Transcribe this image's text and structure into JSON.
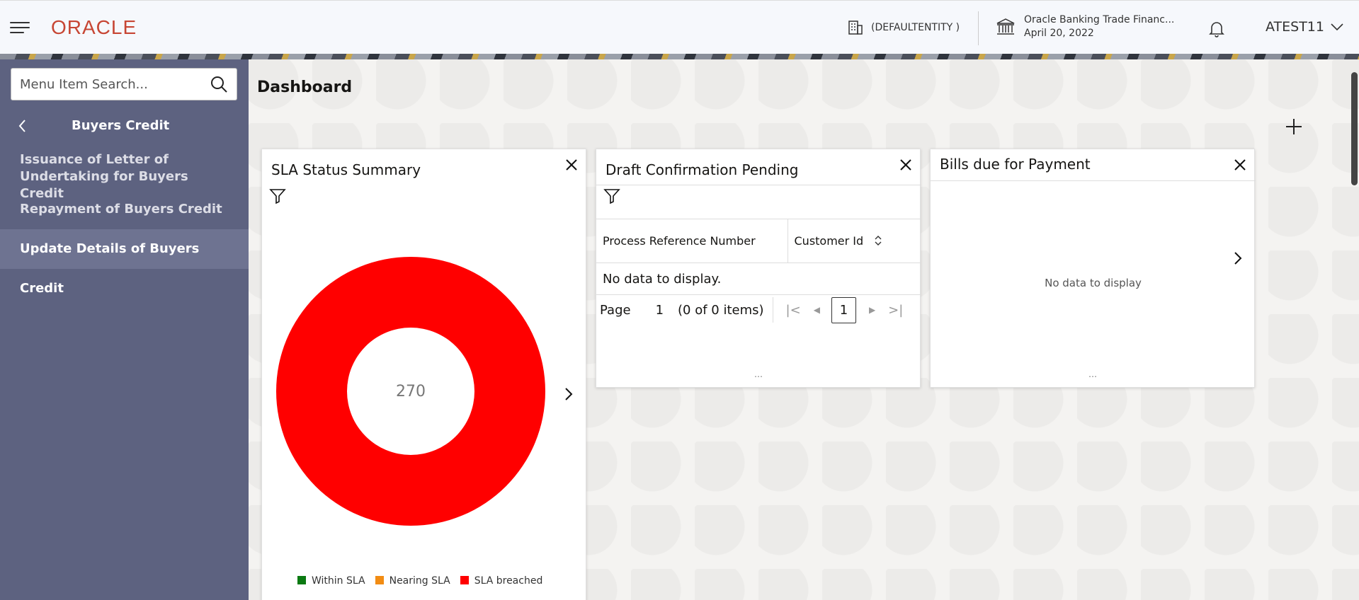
{
  "header": {
    "logo": "ORACLE",
    "entity": "(DEFAULTENTITY )",
    "bank_name": "Oracle Banking Trade Financ...",
    "bank_date": "April 20, 2022",
    "user": "ATEST11"
  },
  "sidebar": {
    "search_placeholder": "Menu Item Search...",
    "title": "Buyers Credit",
    "items": [
      {
        "label": "Issuance of Letter of Undertaking for Buyers Credit",
        "active": false
      },
      {
        "label": "Repayment of Buyers Credit",
        "active": false
      },
      {
        "label": "Update Details of Buyers Credit",
        "active": true
      }
    ]
  },
  "main": {
    "title": "Dashboard",
    "cards": {
      "sla": {
        "title": "SLA Status Summary",
        "center_value": "270",
        "legend": [
          {
            "label": "Within SLA",
            "color": "#0b7a12"
          },
          {
            "label": "Nearing SLA",
            "color": "#f28c13"
          },
          {
            "label": "SLA breached",
            "color": "#ff0000"
          }
        ]
      },
      "draft": {
        "title": "Draft Confirmation Pending",
        "columns": [
          "Process Reference Number",
          "Customer Id"
        ],
        "empty_text": "No data to display.",
        "pager": {
          "label": "Page",
          "page": "1",
          "items": "(0 of 0 items)",
          "current": "1"
        }
      },
      "bills": {
        "title": "Bills due for Payment",
        "empty_text": "No data to display"
      }
    }
  },
  "chart_data": {
    "type": "pie",
    "categories": [
      "Within SLA",
      "Nearing SLA",
      "SLA breached"
    ],
    "values": [
      0,
      0,
      270
    ],
    "title": "SLA Status Summary",
    "legend_position": "bottom"
  }
}
